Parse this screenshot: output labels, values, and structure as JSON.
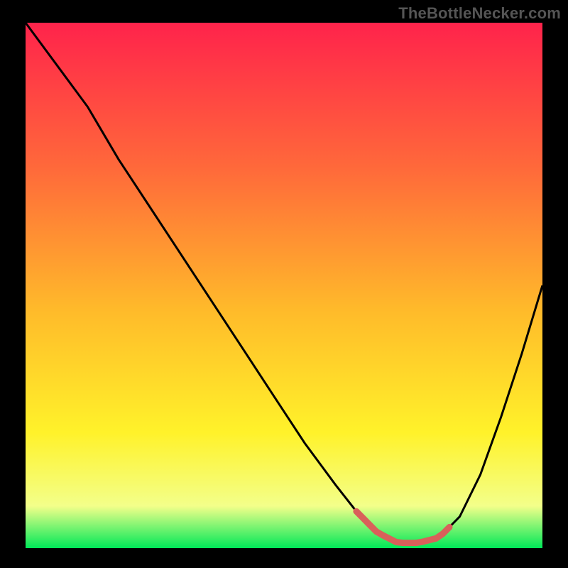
{
  "watermark": "TheBottleNecker.com",
  "colors": {
    "frame": "#000000",
    "gradient_top": "#ff234b",
    "gradient_mid1": "#ff6a3a",
    "gradient_mid2": "#ffbb2a",
    "gradient_mid3": "#fff22a",
    "gradient_bottom_yellow": "#f3ff8a",
    "gradient_green": "#00e858",
    "curve": "#000000",
    "marker": "#d9605a"
  },
  "chart_data": {
    "type": "line",
    "title": "",
    "xlabel": "",
    "ylabel": "",
    "xlim": [
      0,
      100
    ],
    "ylim": [
      0,
      100
    ],
    "series": [
      {
        "name": "bottleneck-curve",
        "x": [
          0,
          6,
          12,
          18,
          24,
          30,
          36,
          42,
          48,
          54,
          60,
          64,
          68,
          72,
          76,
          80,
          84,
          88,
          92,
          96,
          100
        ],
        "y": [
          100,
          92,
          84,
          74,
          65,
          56,
          47,
          38,
          29,
          20,
          12,
          7,
          3,
          1,
          1,
          2,
          6,
          14,
          25,
          37,
          50
        ]
      }
    ],
    "annotations": [
      {
        "name": "optimal-range",
        "type": "highlight",
        "x_start": 64,
        "x_end": 82
      }
    ]
  }
}
